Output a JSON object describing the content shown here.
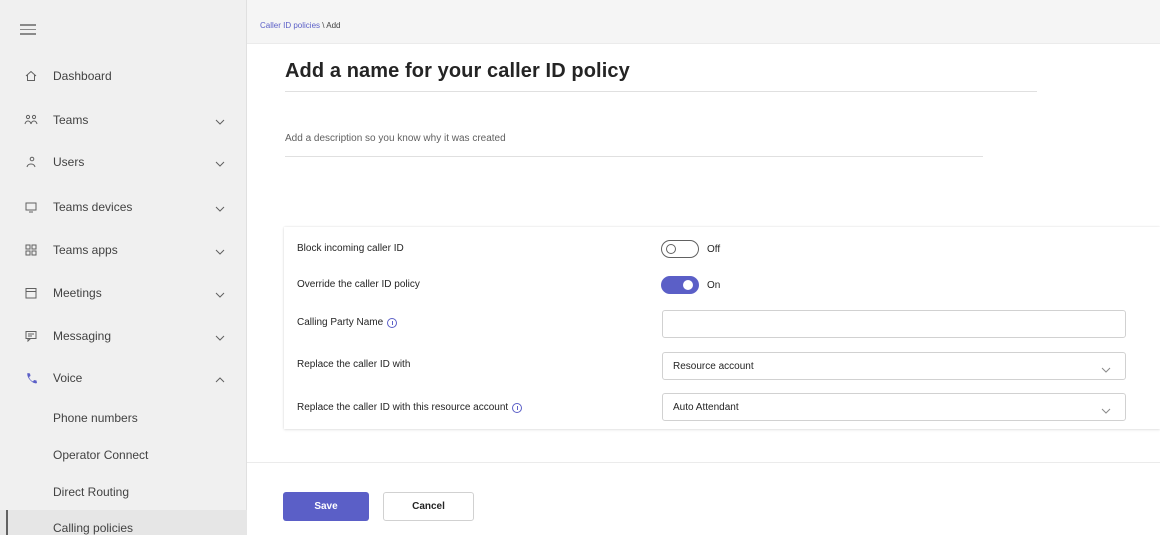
{
  "sidebar": {
    "items": [
      {
        "label": "Dashboard",
        "icon": "home-icon"
      },
      {
        "label": "Teams",
        "icon": "teams-icon"
      },
      {
        "label": "Users",
        "icon": "users-icon"
      },
      {
        "label": "Teams devices",
        "icon": "devices-icon"
      },
      {
        "label": "Teams apps",
        "icon": "apps-icon"
      },
      {
        "label": "Meetings",
        "icon": "calendar-icon"
      },
      {
        "label": "Messaging",
        "icon": "message-icon"
      },
      {
        "label": "Voice",
        "icon": "phone-icon"
      }
    ],
    "voice_subitems": [
      "Phone numbers",
      "Operator Connect",
      "Direct Routing",
      "Calling policies"
    ]
  },
  "breadcrumb": {
    "parent": "Caller ID policies",
    "separator": " \\ ",
    "current": "Add"
  },
  "form": {
    "name_placeholder": "Add a name for your caller ID policy",
    "description_placeholder": "Add a description so you know why it was created",
    "settings": {
      "block_incoming_label": "Block incoming caller ID",
      "block_incoming_state": "Off",
      "override_label": "Override the caller ID policy",
      "override_state": "On",
      "calling_party_label": "Calling Party Name",
      "calling_party_value": "",
      "replace_label": "Replace the caller ID with",
      "replace_value": "Resource account",
      "replace_resource_label": "Replace the caller ID with this resource account",
      "replace_resource_value": "Auto Attendant"
    }
  },
  "buttons": {
    "save": "Save",
    "cancel": "Cancel"
  },
  "colors": {
    "accent": "#5b5fc7",
    "sidebar_bg": "#f0f0f0"
  }
}
